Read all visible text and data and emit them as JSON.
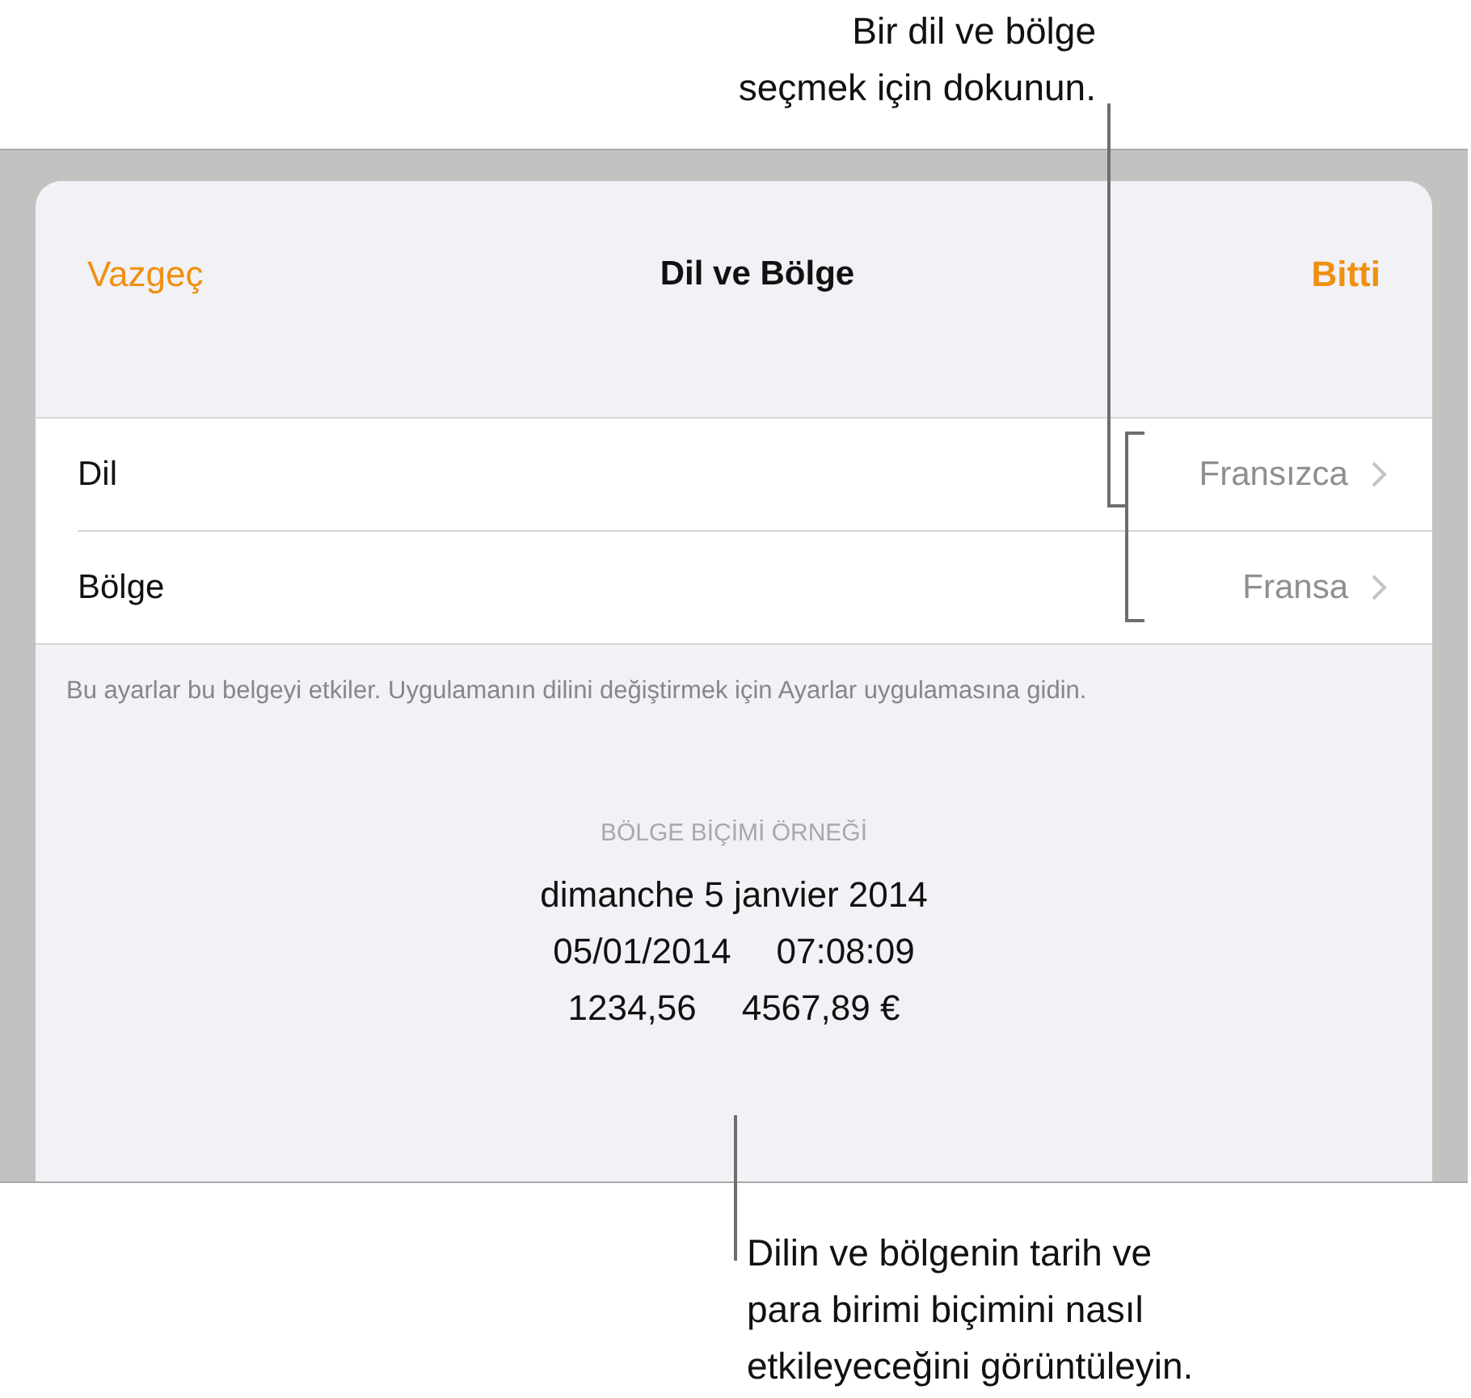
{
  "top_callout": {
    "text": "Bir dil ve bölge\nseçmek için dokunun."
  },
  "dialog": {
    "cancel": "Vazgeç",
    "title": "Dil ve Bölge",
    "done": "Bitti",
    "rows": [
      {
        "label": "Dil",
        "value": "Fransızca"
      },
      {
        "label": "Bölge",
        "value": "Fransa"
      }
    ],
    "note": "Bu ayarlar bu belgeyi etkiler. Uygulamanın dilini değiştirmek için Ayarlar uygulamasına gidin.",
    "sample_heading": "BÖLGE BİÇİMİ ÖRNEĞİ",
    "sample_lines": [
      [
        "dimanche 5 janvier 2014"
      ],
      [
        "05/01/2014",
        "07:08:09"
      ],
      [
        "1234,56",
        "4567,89 €"
      ]
    ]
  },
  "bottom_callout": {
    "text": "Dilin ve bölgenin tarih ve\npara birimi biçimini nasıl\netkileyeceğini görüntüleyin."
  }
}
